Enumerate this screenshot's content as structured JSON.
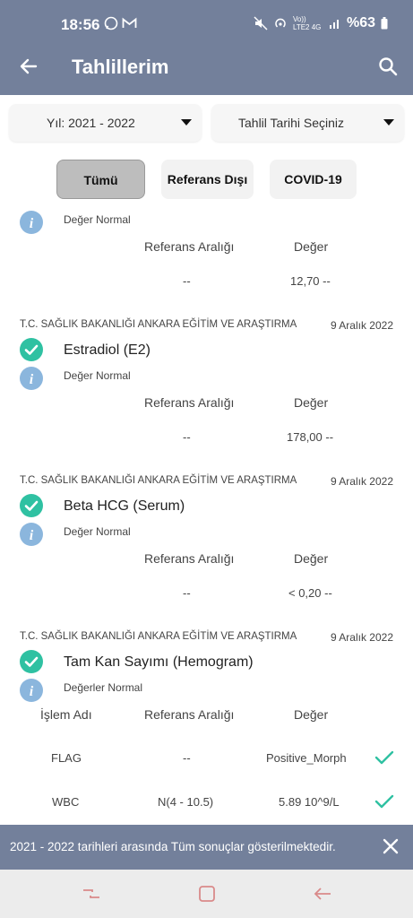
{
  "status_bar": {
    "time": "18:56",
    "signal_label": "Vo)) LTE2 4G",
    "battery": "%63"
  },
  "app_bar": {
    "title": "Tahlillerim"
  },
  "filters": {
    "year": "Yıl: 2021 - 2022",
    "date_select": "Tahlil Tarihi Seçiniz"
  },
  "tabs": [
    "Tümü",
    "Referans Dışı",
    "COVID-19"
  ],
  "first_result": {
    "note": "Değer Normal",
    "ref_header": "Referans Aralığı",
    "value_header": "Değer",
    "ref": "--",
    "value": "12,70 --"
  },
  "results": [
    {
      "hospital": "T.C. SAĞLIK BAKANLIĞI ANKARA EĞİTİM VE ARAŞTIRMA",
      "date": "9 Aralık 2022",
      "name": "Estradiol (E2)",
      "note": "Değer Normal",
      "ref_header": "Referans Aralığı",
      "value_header": "Değer",
      "ref": "--",
      "value": "178,00 --"
    },
    {
      "hospital": "T.C. SAĞLIK BAKANLIĞI ANKARA EĞİTİM VE ARAŞTIRMA",
      "date": "9 Aralık 2022",
      "name": "Beta HCG (Serum)",
      "note": "Değer Normal",
      "ref_header": "Referans Aralığı",
      "value_header": "Değer",
      "ref": "--",
      "value": "< 0,20 --"
    },
    {
      "hospital": "T.C. SAĞLIK BAKANLIĞI ANKARA EĞİTİM VE ARAŞTIRMA",
      "date": "9 Aralık 2022",
      "name": "Tam Kan Sayımı (Hemogram)",
      "note": "Değerler Normal",
      "columns": [
        "İşlem Adı",
        "Referans Aralığı",
        "Değer"
      ],
      "rows": [
        {
          "name": "FLAG",
          "ref": "--",
          "value": "Positive_Morph"
        },
        {
          "name": "WBC",
          "ref": "N(4 - 10.5)",
          "value": "5.89 10^9/L"
        }
      ]
    }
  ],
  "toast": {
    "message": "2021 - 2022 tarihleri arasında Tüm sonuçlar gösterilmektedir."
  },
  "colors": {
    "bar": "#73809b",
    "check": "#2fc1a2",
    "info": "#8bb6dd"
  }
}
